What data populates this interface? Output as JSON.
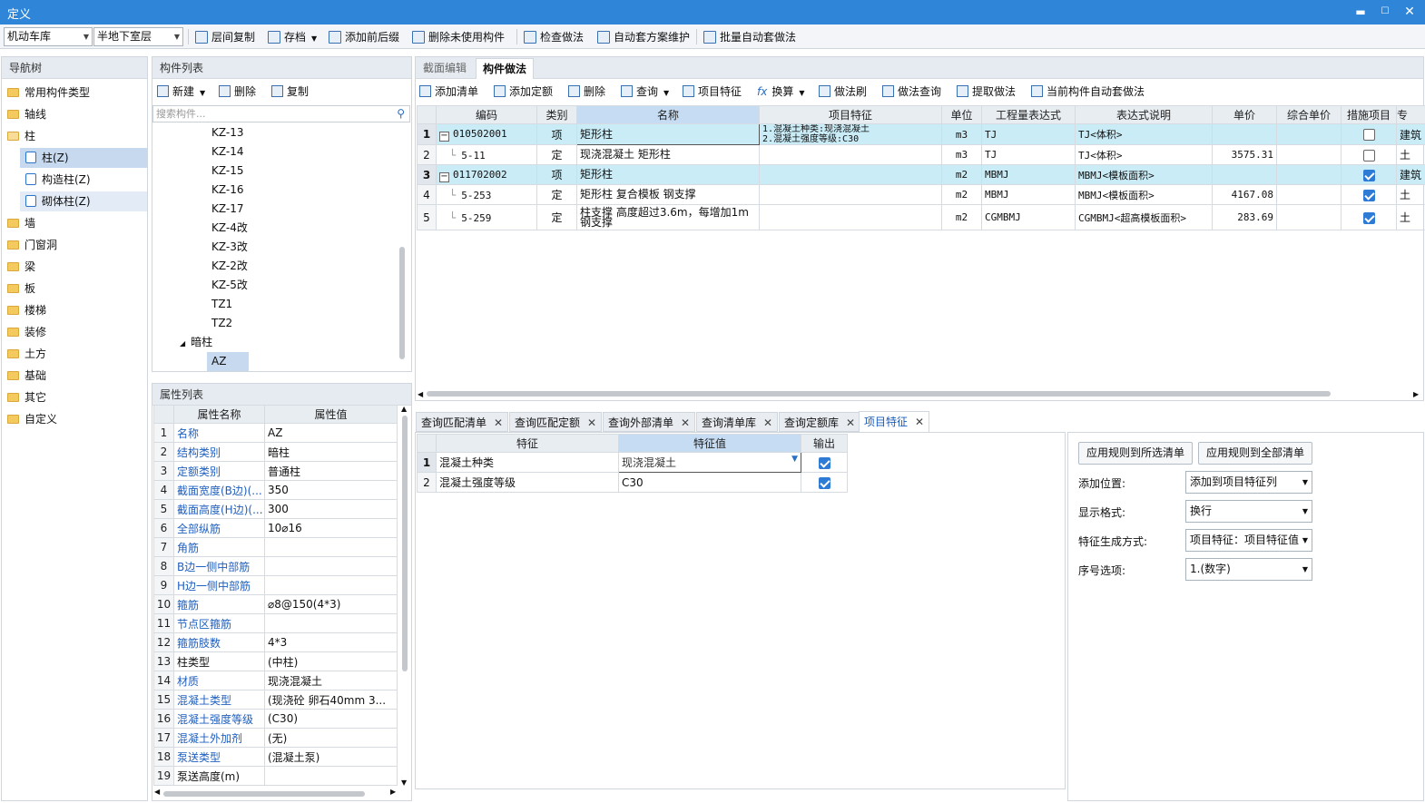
{
  "window": {
    "title": "定义"
  },
  "toolbar": {
    "floor_combo": "机动车库",
    "layer_combo": "半地下室层",
    "buttons": [
      "层间复制",
      "存档",
      "添加前后缀",
      "删除未使用构件",
      "检查做法",
      "自动套方案维护",
      "批量自动套做法"
    ]
  },
  "nav": {
    "header": "导航树",
    "items": [
      {
        "label": "常用构件类型",
        "indent": 0
      },
      {
        "label": "轴线",
        "indent": 0
      },
      {
        "label": "柱",
        "indent": 0
      },
      {
        "label": "柱(Z)",
        "indent": 1
      },
      {
        "label": "构造柱(Z)",
        "indent": 1
      },
      {
        "label": "砌体柱(Z)",
        "indent": 1
      },
      {
        "label": "墙",
        "indent": 0
      },
      {
        "label": "门窗洞",
        "indent": 0
      },
      {
        "label": "梁",
        "indent": 0
      },
      {
        "label": "板",
        "indent": 0
      },
      {
        "label": "楼梯",
        "indent": 0
      },
      {
        "label": "装修",
        "indent": 0
      },
      {
        "label": "土方",
        "indent": 0
      },
      {
        "label": "基础",
        "indent": 0
      },
      {
        "label": "其它",
        "indent": 0
      },
      {
        "label": "自定义",
        "indent": 0
      }
    ]
  },
  "component_list": {
    "header": "构件列表",
    "new_label": "新建",
    "delete_label": "删除",
    "copy_label": "复制",
    "search_placeholder": "搜索构件...",
    "items": [
      "KZ-13",
      "KZ-14",
      "KZ-15",
      "KZ-16",
      "KZ-17",
      "KZ-4改",
      "KZ-3改",
      "KZ-2改",
      "KZ-5改",
      "TZ1",
      "TZ2"
    ],
    "group_label": "暗柱",
    "selected_item": "AZ"
  },
  "properties": {
    "header": "属性列表",
    "col_name": "属性名称",
    "col_value": "属性值",
    "rows": [
      {
        "n": "1",
        "name": "名称",
        "value": "AZ",
        "blue": true
      },
      {
        "n": "2",
        "name": "结构类别",
        "value": "暗柱",
        "blue": true
      },
      {
        "n": "3",
        "name": "定额类别",
        "value": "普通柱",
        "blue": true
      },
      {
        "n": "4",
        "name": "截面宽度(B边)(...",
        "value": "350",
        "blue": true
      },
      {
        "n": "5",
        "name": "截面高度(H边)(...",
        "value": "300",
        "blue": true
      },
      {
        "n": "6",
        "name": "全部纵筋",
        "value": "10⌀16",
        "blue": true
      },
      {
        "n": "7",
        "name": "角筋",
        "value": "",
        "blue": true
      },
      {
        "n": "8",
        "name": "B边一侧中部筋",
        "value": "",
        "blue": true
      },
      {
        "n": "9",
        "name": "H边一侧中部筋",
        "value": "",
        "blue": true
      },
      {
        "n": "10",
        "name": "箍筋",
        "value": "⌀8@150(4*3)",
        "blue": true
      },
      {
        "n": "11",
        "name": "节点区箍筋",
        "value": "",
        "blue": true
      },
      {
        "n": "12",
        "name": "箍筋肢数",
        "value": "4*3",
        "blue": true
      },
      {
        "n": "13",
        "name": "柱类型",
        "value": "(中柱)",
        "blue": false
      },
      {
        "n": "14",
        "name": "材质",
        "value": "现浇混凝土",
        "blue": true
      },
      {
        "n": "15",
        "name": "混凝土类型",
        "value": "(现浇砼 卵石40mm 3...",
        "blue": true
      },
      {
        "n": "16",
        "name": "混凝土强度等级",
        "value": "(C30)",
        "blue": true
      },
      {
        "n": "17",
        "name": "混凝土外加剂",
        "value": "(无)",
        "blue": true
      },
      {
        "n": "18",
        "name": "泵送类型",
        "value": "(混凝土泵)",
        "blue": true
      },
      {
        "n": "19",
        "name": "泵送高度(m)",
        "value": "",
        "blue": false
      }
    ]
  },
  "method": {
    "tab_section": "截面编辑",
    "tab_method": "构件做法",
    "actions": [
      "添加清单",
      "添加定额",
      "删除",
      "查询",
      "项目特征",
      "换算",
      "做法刷",
      "做法查询",
      "提取做法",
      "当前构件自动套做法"
    ],
    "columns": [
      "编码",
      "类别",
      "名称",
      "项目特征",
      "单位",
      "工程量表达式",
      "表达式说明",
      "单价",
      "综合单价",
      "措施项目",
      "专"
    ],
    "rows": [
      {
        "n": "1",
        "code": "010502001",
        "type": "项",
        "name": "矩形柱",
        "feature": "1.混凝土种类:现浇混凝土\n2.混凝土强度等级:C30",
        "unit": "m3",
        "expr": "TJ",
        "desc": "TJ<体积>",
        "price": "",
        "total": "",
        "measure": false,
        "extra": "建筑",
        "kind": "list"
      },
      {
        "n": "2",
        "code": "5-11",
        "type": "定",
        "name": "现浇混凝土 矩形柱",
        "feature": "",
        "unit": "m3",
        "expr": "TJ",
        "desc": "TJ<体积>",
        "price": "3575.31",
        "total": "",
        "measure": false,
        "extra": "土",
        "kind": "quota"
      },
      {
        "n": "3",
        "code": "011702002",
        "type": "项",
        "name": "矩形柱",
        "feature": "",
        "unit": "m2",
        "expr": "MBMJ",
        "desc": "MBMJ<模板面积>",
        "price": "",
        "total": "",
        "measure": true,
        "extra": "建筑",
        "kind": "list"
      },
      {
        "n": "4",
        "code": "5-253",
        "type": "定",
        "name": "矩形柱 复合模板 钢支撑",
        "feature": "",
        "unit": "m2",
        "expr": "MBMJ",
        "desc": "MBMJ<模板面积>",
        "price": "4167.08",
        "total": "",
        "measure": true,
        "extra": "土",
        "kind": "quota"
      },
      {
        "n": "5",
        "code": "5-259",
        "type": "定",
        "name": "柱支撑 高度超过3.6m，每增加1m 钢支撑",
        "feature": "",
        "unit": "m2",
        "expr": "CGMBMJ",
        "desc": "CGMBMJ<超高模板面积>",
        "price": "283.69",
        "total": "",
        "measure": true,
        "extra": "土",
        "kind": "quota"
      }
    ]
  },
  "bottom_tabs": [
    "查询匹配清单",
    "查询匹配定额",
    "查询外部清单",
    "查询清单库",
    "查询定额库",
    "项目特征"
  ],
  "feature_table": {
    "col_feature": "特征",
    "col_value": "特征值",
    "col_output": "输出",
    "rows": [
      {
        "n": "1",
        "feature": "混凝土种类",
        "value": "现浇混凝土",
        "output": true
      },
      {
        "n": "2",
        "feature": "混凝土强度等级",
        "value": "C30",
        "output": true
      }
    ]
  },
  "feature_settings": {
    "apply_selected": "应用规则到所选清单",
    "apply_all": "应用规则到全部清单",
    "fields": [
      {
        "label": "添加位置:",
        "value": "添加到项目特征列"
      },
      {
        "label": "显示格式:",
        "value": "换行"
      },
      {
        "label": "特征生成方式:",
        "value": "项目特征：项目特征值"
      },
      {
        "label": "序号选项:",
        "value": "1.(数字)"
      }
    ]
  },
  "colors": {
    "titlebar": "#2f86d8",
    "selected_row": "#c9ecf7",
    "link_blue": "#1f5fbf"
  }
}
